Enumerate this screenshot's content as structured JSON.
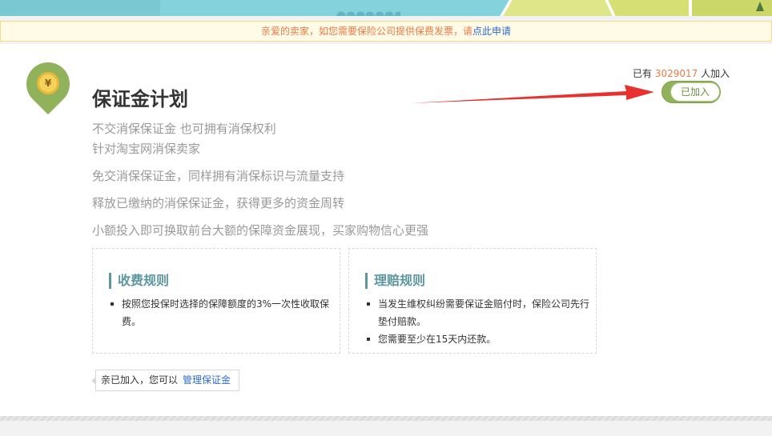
{
  "notice": {
    "text": "亲爱的卖家，如您需要保险公司提供保费发票，请",
    "link": "点此申请"
  },
  "plan": {
    "icon_symbol": "¥",
    "title": "保证金计划",
    "lines": [
      "不交消保保证金 也可拥有消保权利",
      "针对淘宝网消保卖家",
      "免交消保保证金，同样拥有消保标识与流量支持",
      "释放已缴纳的消保保证金，获得更多的资金周转",
      "小额投入即可换取前台大额的保障资金展现，买家购物信心更强"
    ]
  },
  "joined": {
    "prefix": "已有",
    "count": "3029017",
    "suffix": "人加入",
    "toggle_label": "已加入"
  },
  "rules": [
    {
      "title": "收费规则",
      "items": [
        "按照您投保时选择的保障额度的3%一次性收取保费。"
      ]
    },
    {
      "title": "理赔规则",
      "items": [
        "当发生维权纠纷需要保证金赔付时，保险公司先行垫付赔款。",
        "您需要至少在15天内还款。"
      ]
    }
  ],
  "manage": {
    "text": "亲已加入，您可以",
    "link": "管理保证金"
  },
  "colors": {
    "accent_green": "#8fb25a",
    "rule_title": "#5c97a1",
    "notice_orange": "#ee7a45",
    "link_blue": "#2e6bd1",
    "arrow_red": "#e8312f"
  }
}
